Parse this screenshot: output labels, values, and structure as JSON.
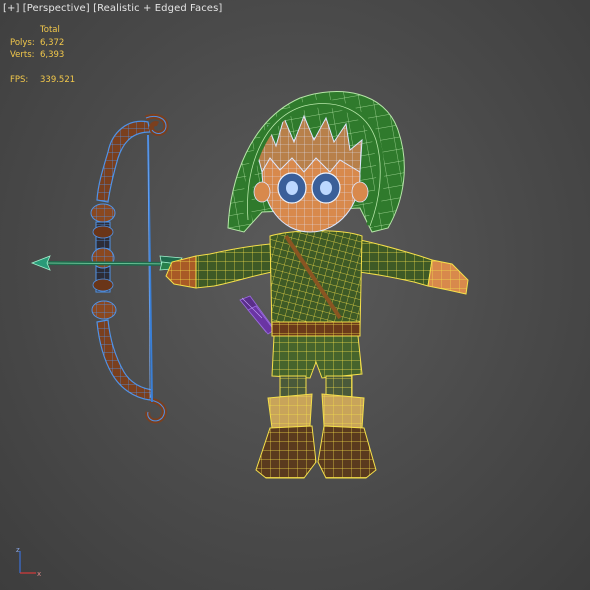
{
  "viewport": {
    "label": {
      "plus": "[+]",
      "view": "[Perspective]",
      "shading": "[Realistic + Edged Faces]"
    }
  },
  "stats": {
    "header": "Total",
    "polys_label": "Polys:",
    "polys_value": "6,372",
    "verts_label": "Verts:",
    "verts_value": "6,393",
    "fps_label": "FPS:",
    "fps_value": "339.521"
  },
  "scene": {
    "object": "archer-character",
    "props": [
      "bow",
      "arrow",
      "quiver"
    ],
    "wire_color_selected": "#f5e04a",
    "wire_color_bow": "#3a7fd6",
    "wire_color_head": "#dde7ff",
    "hood_color": "#2f7a2c",
    "tunic_color": "#3e5a26",
    "skin_color": "#d8894c",
    "bow_wood_color": "#7a3f1e"
  },
  "axis_gizmo": {
    "z": "z",
    "x": "x",
    "z_color": "#3a6fd8",
    "x_color": "#d83a3a"
  }
}
